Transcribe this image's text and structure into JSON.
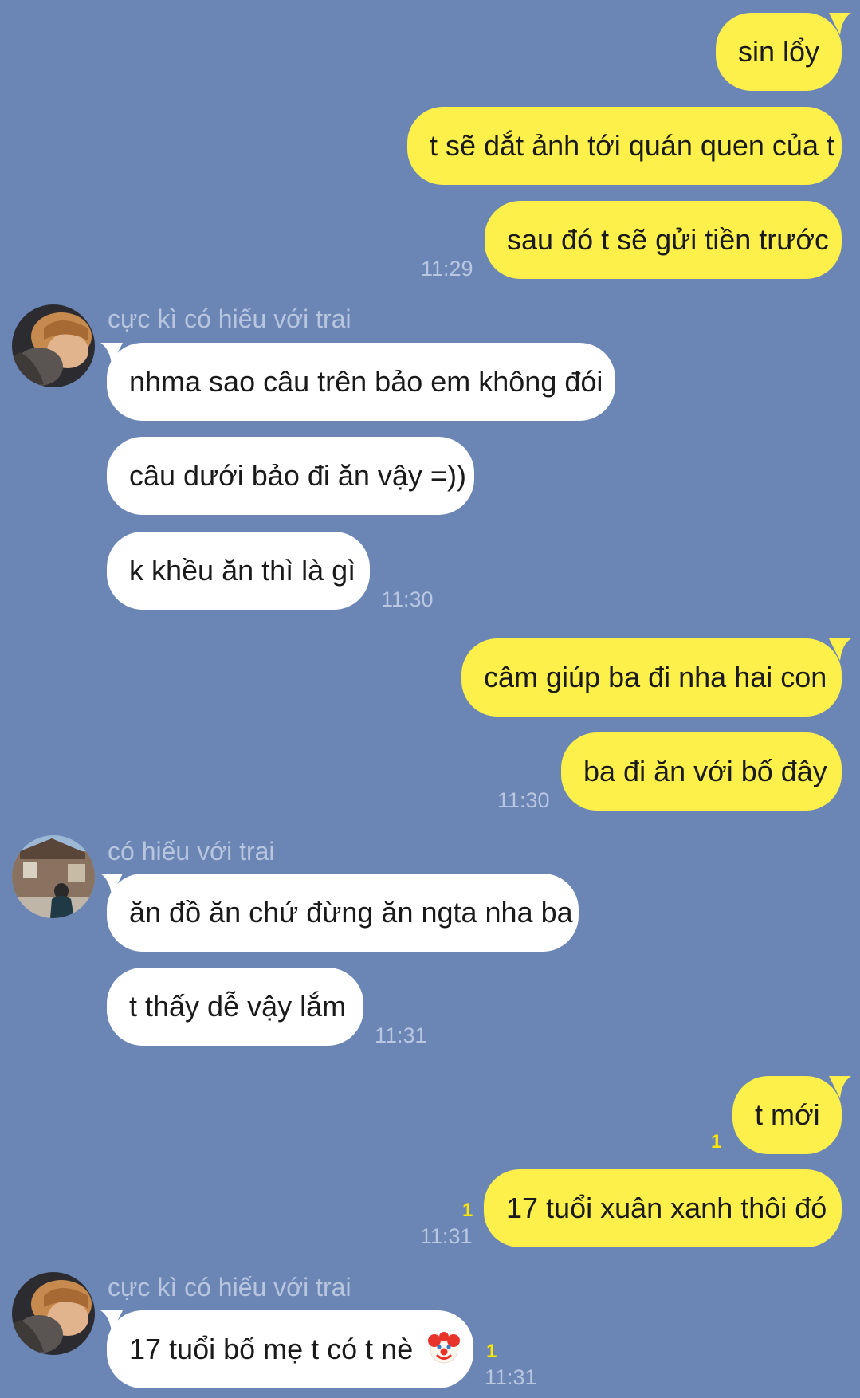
{
  "conversation": {
    "groups": [
      {
        "direction": "sent",
        "messages": [
          "sin lổy",
          "t sẽ dắt ảnh tới quán quen của t",
          "sau đó t sẽ gửi tiền trước"
        ],
        "time": "11:29"
      },
      {
        "direction": "received",
        "sender": "cực kì có hiếu với trai",
        "messages": [
          "nhma sao câu trên bảo em không đói",
          "câu dưới bảo đi ăn vậy =))",
          "k khều ăn thì là gì"
        ],
        "time": "11:30"
      },
      {
        "direction": "sent",
        "messages": [
          "câm giúp ba đi nha hai con",
          "ba đi ăn với bố đây"
        ],
        "time": "11:30"
      },
      {
        "direction": "received",
        "sender": "có hiếu với trai",
        "messages": [
          "ăn đồ ăn chứ đừng ăn ngta nha ba",
          "t thấy dễ vậy lắm"
        ],
        "time": "11:31"
      },
      {
        "direction": "sent",
        "messages": [
          "t mới",
          "17 tuổi xuân xanh thôi đó"
        ],
        "read_counts": [
          "1",
          "1"
        ],
        "time": "11:31"
      },
      {
        "direction": "received",
        "sender": "cực kì có hiếu với trai",
        "messages": [
          "17 tuổi bố mẹ t có t nè"
        ],
        "emoji": "clown-face",
        "read_count": "1",
        "time": "11:31"
      }
    ]
  },
  "colors": {
    "background": "#6b86b5",
    "sent_bubble": "#fdf04b",
    "received_bubble": "#ffffff",
    "read_count": "#ffe600"
  }
}
